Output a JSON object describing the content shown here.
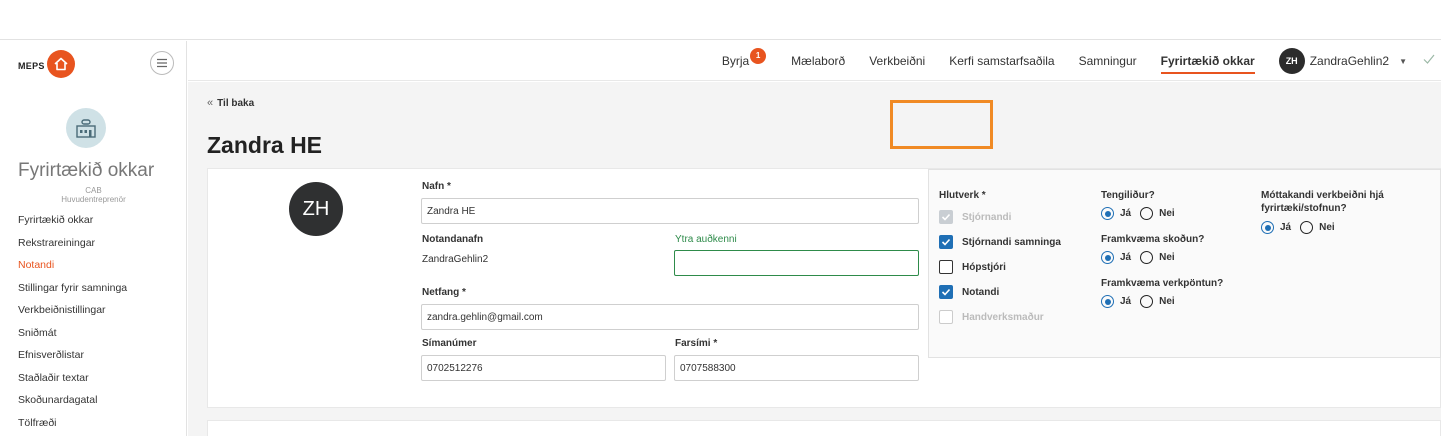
{
  "sidebar": {
    "brand": "MEPS",
    "company_name": "Fyrirtækið okkar",
    "company_code": "CAB",
    "company_role": "Huvudentreprenör",
    "items": [
      {
        "label": "Fyrirtækið okkar"
      },
      {
        "label": "Rekstrareiningar"
      },
      {
        "label": "Notandi"
      },
      {
        "label": "Stillingar fyrir samninga"
      },
      {
        "label": "Verkbeiðnistillingar"
      },
      {
        "label": "Sniðmát"
      },
      {
        "label": "Efnisverðlistar"
      },
      {
        "label": "Staðlaðir textar"
      },
      {
        "label": "Skoðunardagatal"
      },
      {
        "label": "Tölfræði"
      }
    ],
    "active_item": "Notandi"
  },
  "topnav": {
    "items": [
      {
        "label": "Byrja",
        "badge": "1"
      },
      {
        "label": "Mælaborð"
      },
      {
        "label": "Verkbeiðni"
      },
      {
        "label": "Kerfi samstarfsaðila"
      },
      {
        "label": "Samningur"
      },
      {
        "label": "Fyrirtækið okkar"
      }
    ],
    "active_item": "Fyrirtækið okkar",
    "user_initials": "ZH",
    "user_name": "ZandraGehlin2"
  },
  "back_label": "Til baka",
  "page_title": "Zandra HE",
  "form": {
    "avatar_initials": "ZH",
    "name_label": "Nafn *",
    "name_value": "Zandra HE",
    "username_label": "Notandanafn",
    "username_value": "ZandraGehlin2",
    "external_id_label": "Ytra auðkenni",
    "external_id_value": "",
    "email_label": "Netfang *",
    "email_value": "zandra.gehlin@gmail.com",
    "phone_label": "Símanúmer",
    "phone_value": "0702512276",
    "mobile_label": "Farsími *",
    "mobile_value": "0707588300"
  },
  "roles": {
    "label": "Hlutverk *",
    "items": [
      {
        "label": "Stjórnandi",
        "checked": true,
        "disabled": true
      },
      {
        "label": "Stjórnandi samninga",
        "checked": true,
        "disabled": false
      },
      {
        "label": "Hópstjóri",
        "checked": false,
        "disabled": false
      },
      {
        "label": "Notandi",
        "checked": true,
        "disabled": false
      },
      {
        "label": "Handverksmaður",
        "checked": false,
        "disabled": true
      }
    ]
  },
  "questions": {
    "contact": {
      "label": "Tengiliður?",
      "yes": "Já",
      "no": "Nei",
      "selected": "yes"
    },
    "inspection": {
      "label": "Framkvæma skoðun?",
      "yes": "Já",
      "no": "Nei",
      "selected": "yes"
    },
    "work_order": {
      "label": "Framkvæma verkpöntun?",
      "yes": "Já",
      "no": "Nei",
      "selected": "yes"
    },
    "recipient": {
      "label_line1": "Móttakandi verkbeiðni hjá",
      "label_line2": "fyrirtæki/stofnun?",
      "yes": "Já",
      "no": "Nei",
      "selected": "yes"
    }
  },
  "colors": {
    "accent": "#e8541f",
    "primary": "#1f6fb5",
    "highlight": "#f08a24",
    "green": "#2e8b4a"
  }
}
